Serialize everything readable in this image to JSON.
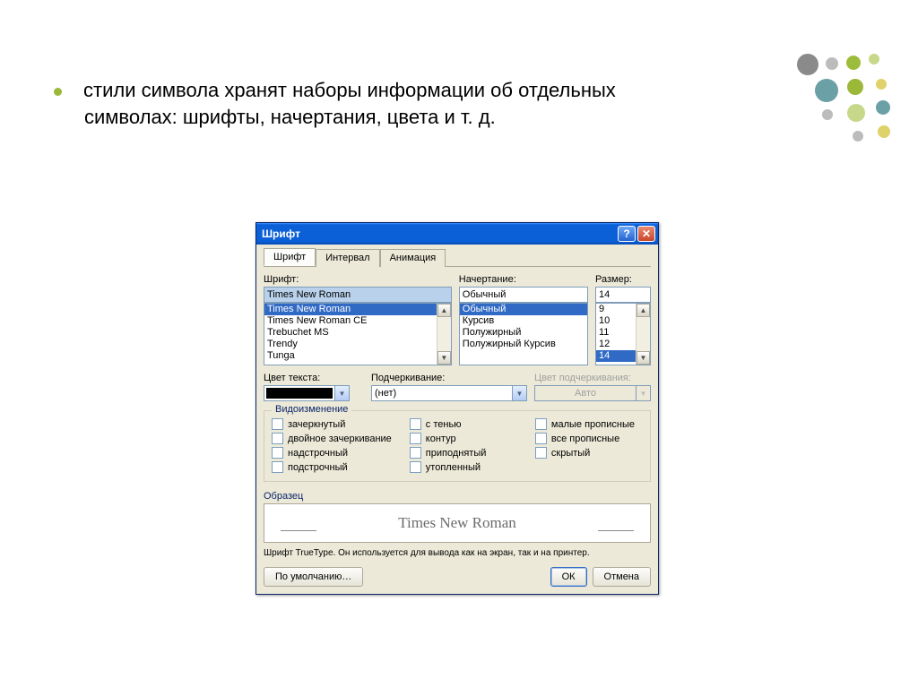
{
  "slide": {
    "bullet_text": "стили символа хранят наборы информации об отдельных символах: шрифты, начертания, цвета и т. д."
  },
  "dialog": {
    "title": "Шрифт",
    "tabs": {
      "font": "Шрифт",
      "interval": "Интервал",
      "animation": "Анимация"
    },
    "labels": {
      "font": "Шрифт:",
      "style": "Начертание:",
      "size": "Размер:",
      "text_color": "Цвет текста:",
      "underline": "Подчеркивание:",
      "underline_color": "Цвет подчеркивания:"
    },
    "values": {
      "font": "Times New Roman",
      "style": "Обычный",
      "size": "14",
      "underline": "(нет)",
      "underline_color": "Авто"
    },
    "font_list": [
      "Times New Roman",
      "Times New Roman CE",
      "Trebuchet MS",
      "Trendy",
      "Tunga"
    ],
    "style_list": [
      "Обычный",
      "Курсив",
      "Полужирный",
      "Полужирный Курсив"
    ],
    "size_list": [
      "9",
      "10",
      "11",
      "12",
      "14"
    ],
    "effects": {
      "legend": "Видоизменение",
      "col1": [
        "зачеркнутый",
        "двойное зачеркивание",
        "надстрочный",
        "подстрочный"
      ],
      "col2": [
        "с тенью",
        "контур",
        "приподнятый",
        "утопленный"
      ],
      "col3": [
        "малые прописные",
        "все прописные",
        "скрытый"
      ]
    },
    "sample": {
      "label": "Образец",
      "text": "Times New Roman"
    },
    "hint": "Шрифт TrueType. Он используется для вывода как на экран, так и на принтер.",
    "buttons": {
      "default": "По умолчанию…",
      "ok": "ОК",
      "cancel": "Отмена"
    }
  }
}
